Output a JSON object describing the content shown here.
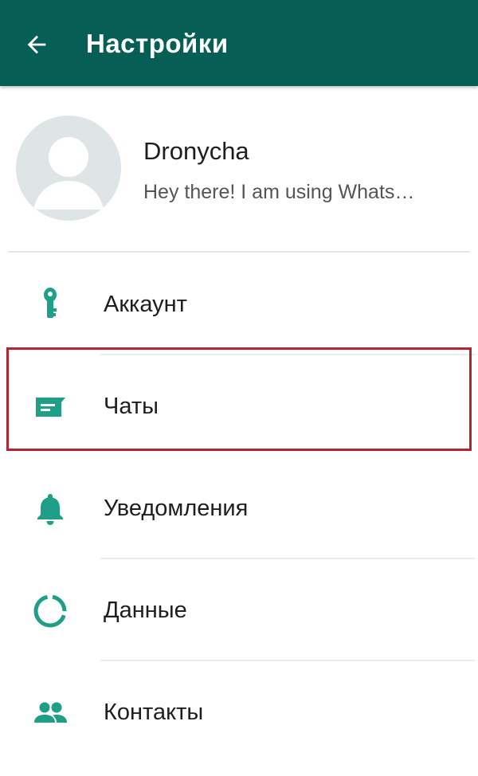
{
  "appbar": {
    "title": "Настройки",
    "back_icon": "arrow-back-icon",
    "color": "#075e54"
  },
  "profile": {
    "name": "Dronycha",
    "status": "Hey there! I am using Whats…",
    "avatar_icon": "default-avatar-icon"
  },
  "menu": {
    "items": [
      {
        "label": "Аккаунт",
        "icon": "key-icon"
      },
      {
        "label": "Чаты",
        "icon": "chat-icon"
      },
      {
        "label": "Уведомления",
        "icon": "bell-icon"
      },
      {
        "label": "Данные",
        "icon": "data-usage-icon"
      },
      {
        "label": "Контакты",
        "icon": "contacts-icon"
      }
    ]
  },
  "highlight": {
    "item": "Чаты",
    "color": "#b3262e"
  },
  "colors": {
    "accent": "#1f9e88",
    "text_primary": "#1e1e1e",
    "text_secondary": "#555555"
  }
}
